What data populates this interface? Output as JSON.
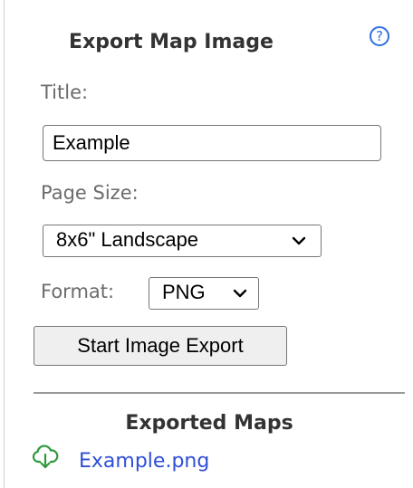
{
  "panel": {
    "title": "Export Map Image",
    "help_icon": "question-circle-icon",
    "help_glyph": "?"
  },
  "form": {
    "title_label": "Title:",
    "title_value": "Example",
    "page_size_label": "Page Size:",
    "page_size_value": "8x6\" Landscape",
    "format_label": "Format:",
    "format_value": "PNG",
    "export_button_label": "Start Image Export"
  },
  "exported": {
    "heading": "Exported Maps",
    "items": [
      {
        "icon": "cloud-download-icon",
        "label": "Example.png"
      }
    ]
  },
  "colors": {
    "accent": "#2f6fe4",
    "link": "#2f4fd6",
    "download_icon": "#2e9a3e"
  }
}
